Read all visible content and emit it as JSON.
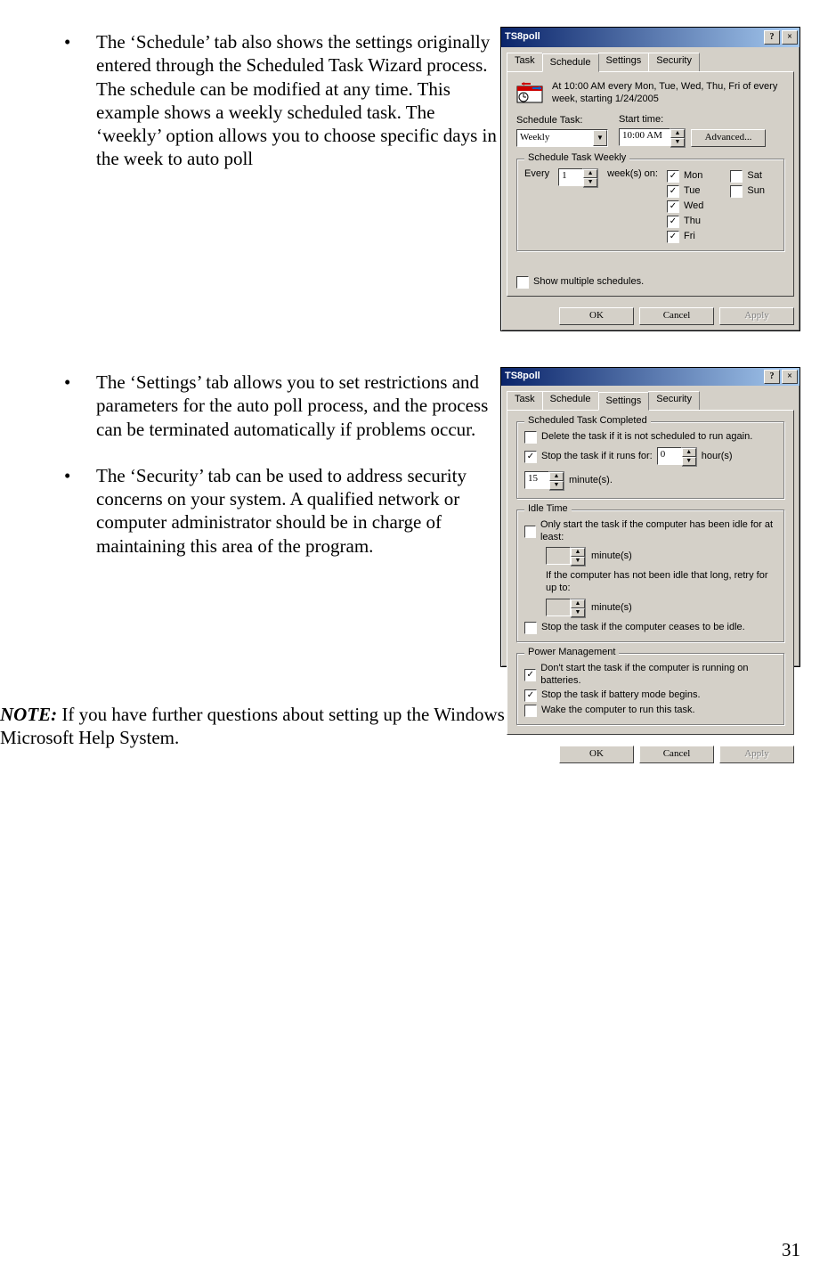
{
  "page_number": "31",
  "bullets_top": [
    "The ‘Schedule’ tab also shows the settings originally entered through the Scheduled Task Wizard process.  The schedule can be modified at any time.  This example shows a weekly scheduled task.  The ‘weekly’ option allows you to choose specific days in the week to auto poll"
  ],
  "bullets_mid": [
    "The ‘Settings’ tab allows you to set restrictions and parameters for the auto poll process, and the process can be terminated automatically if problems occur.",
    "The ‘Security’ tab can be used to address security concerns on your system.  A qualified network or computer administrator should be in charge of maintaining this area of the program."
  ],
  "note": {
    "label": "NOTE:",
    "text": "  If you have further questions about setting up the Windows Scheduler, please refer to your Microsoft Help System."
  },
  "dlg1": {
    "title": "TS8poll",
    "help": "?",
    "close": "×",
    "tabs": [
      "Task",
      "Schedule",
      "Settings",
      "Security"
    ],
    "active_tab": 1,
    "summary": "At 10:00 AM every Mon, Tue, Wed, Thu, Fri of every week, starting 1/24/2005",
    "schedule_task_label": "Schedule Task:",
    "schedule_task_value": "Weekly",
    "start_time_label": "Start time:",
    "start_time_value": "10:00 AM",
    "advanced": "Advanced...",
    "group_weekly": "Schedule Task Weekly",
    "every_label": "Every",
    "every_value": "1",
    "weeks_on_label": "week(s) on:",
    "days": {
      "mon": "Mon",
      "tue": "Tue",
      "wed": "Wed",
      "thu": "Thu",
      "fri": "Fri",
      "sat": "Sat",
      "sun": "Sun"
    },
    "show_multiple": "Show multiple schedules.",
    "ok": "OK",
    "cancel": "Cancel",
    "apply": "Apply"
  },
  "dlg2": {
    "title": "TS8poll",
    "help": "?",
    "close": "×",
    "tabs": [
      "Task",
      "Schedule",
      "Settings",
      "Security"
    ],
    "active_tab": 2,
    "grp_completed": "Scheduled Task Completed",
    "del_task": "Delete the task if it is not scheduled to run again.",
    "stop_task": "Stop the task if it runs for:",
    "hours_val": "0",
    "hours_lbl": "hour(s)",
    "mins_val": "15",
    "mins_lbl": "minute(s).",
    "grp_idle": "Idle Time",
    "idle1": "Only start the task if the computer has been idle for at least:",
    "idle_min_lbl": "minute(s)",
    "idle2": "If the computer has not been idle that long, retry for up to:",
    "idle3": "Stop the task if the computer ceases to be idle.",
    "grp_power": "Power Management",
    "pm1": "Don't start the task if the computer is running on batteries.",
    "pm2": "Stop the task if battery mode begins.",
    "pm3": "Wake the computer to run this task.",
    "ok": "OK",
    "cancel": "Cancel",
    "apply": "Apply"
  }
}
